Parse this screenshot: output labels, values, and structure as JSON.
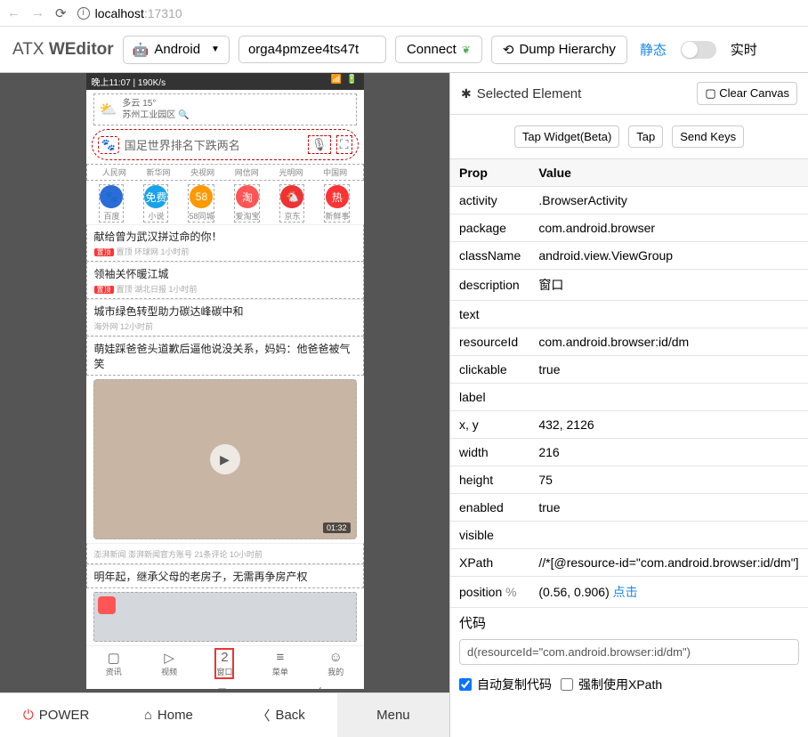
{
  "browser": {
    "host": "localhost",
    "port": ":17310"
  },
  "toolbar": {
    "brand1": "ATX ",
    "brand2": "WEditor",
    "platform": "Android",
    "address_value": "orga4pmzee4ts47t",
    "connect": "Connect",
    "dump": "Dump Hierarchy",
    "static": "静态",
    "realtime": "实时"
  },
  "footer": {
    "power": "POWER",
    "home": "Home",
    "back": "Back",
    "menu": "Menu"
  },
  "phone": {
    "status_left": "晚上11:07 | 190K/s",
    "weather_line1": "多云 15°",
    "weather_line2": "苏州工业园区",
    "search_value": "国足世界排名下跌两名",
    "site_tags": [
      "人民网",
      "新华网",
      "央视网",
      "网信网",
      "光明网",
      "中国网"
    ],
    "quick": [
      {
        "label": "百度",
        "color": "#2b6cd6",
        "txt": "🐾"
      },
      {
        "label": "小说",
        "color": "#1aa3e8",
        "txt": "免费"
      },
      {
        "label": "58同城",
        "color": "#f90",
        "txt": "58"
      },
      {
        "label": "爱淘宝",
        "color": "#f55",
        "txt": "淘"
      },
      {
        "label": "京东",
        "color": "#e33",
        "txt": "🐔"
      },
      {
        "label": "新鲜事",
        "color": "#f33",
        "txt": "热"
      }
    ],
    "news": [
      {
        "title": "献给曾为武汉拼过命的你！",
        "meta": "置顶  环球网  1小时前",
        "top": true
      },
      {
        "title": "领袖关怀暖江城",
        "meta": "置顶  湖北日报  1小时前",
        "top": true
      },
      {
        "title": "城市绿色转型助力碳达峰碳中和",
        "meta": "海外网  12小时前"
      },
      {
        "title": "萌娃踩爸爸头道歉后逼他说没关系，妈妈：他爸爸被气笑",
        "meta": ""
      }
    ],
    "video_time": "01:32",
    "video_meta": "澎湃新闻 澎湃新闻官方账号  21条评论  10小时前",
    "news5": "明年起，继承父母的老房子，无需再争房产权",
    "bottom_nav": [
      {
        "label": "资讯",
        "icon": "▢"
      },
      {
        "label": "视频",
        "icon": "▷"
      },
      {
        "label": "窗口",
        "icon": "2",
        "sel": true
      },
      {
        "label": "菜单",
        "icon": "≡"
      },
      {
        "label": "我的",
        "icon": "☺"
      }
    ]
  },
  "selected": {
    "header": "Selected Element",
    "clear": "Clear Canvas",
    "actions": {
      "tap_widget": "Tap Widget(Beta)",
      "tap": "Tap",
      "send_keys": "Send Keys"
    },
    "th_prop": "Prop",
    "th_value": "Value",
    "props": {
      "activity": ".BrowserActivity",
      "package": "com.android.browser",
      "className": "android.view.ViewGroup",
      "description": "窗口",
      "text": "",
      "resourceId": "com.android.browser:id/dm",
      "clickable": "true",
      "label": "",
      "xy": "432, 2126",
      "width": "216",
      "height": "75",
      "enabled": "true",
      "visible": "",
      "xpath": "//*[@resource-id=\"com.android.browser:id/dm\"]",
      "position_val": "(0.56, 0.906) ",
      "position_link": "点击"
    },
    "labels": {
      "activity": "activity",
      "package": "package",
      "className": "className",
      "description": "description",
      "text": "text",
      "resourceId": "resourceId",
      "clickable": "clickable",
      "label": "label",
      "xy": "x, y",
      "width": "width",
      "height": "height",
      "enabled": "enabled",
      "visible": "visible",
      "xpath": "XPath",
      "position": "position"
    },
    "code_label": "代码",
    "code_value": "d(resourceId=\"com.android.browser:id/dm\")",
    "auto_copy": "自动复制代码",
    "force_xpath": "强制使用XPath"
  }
}
